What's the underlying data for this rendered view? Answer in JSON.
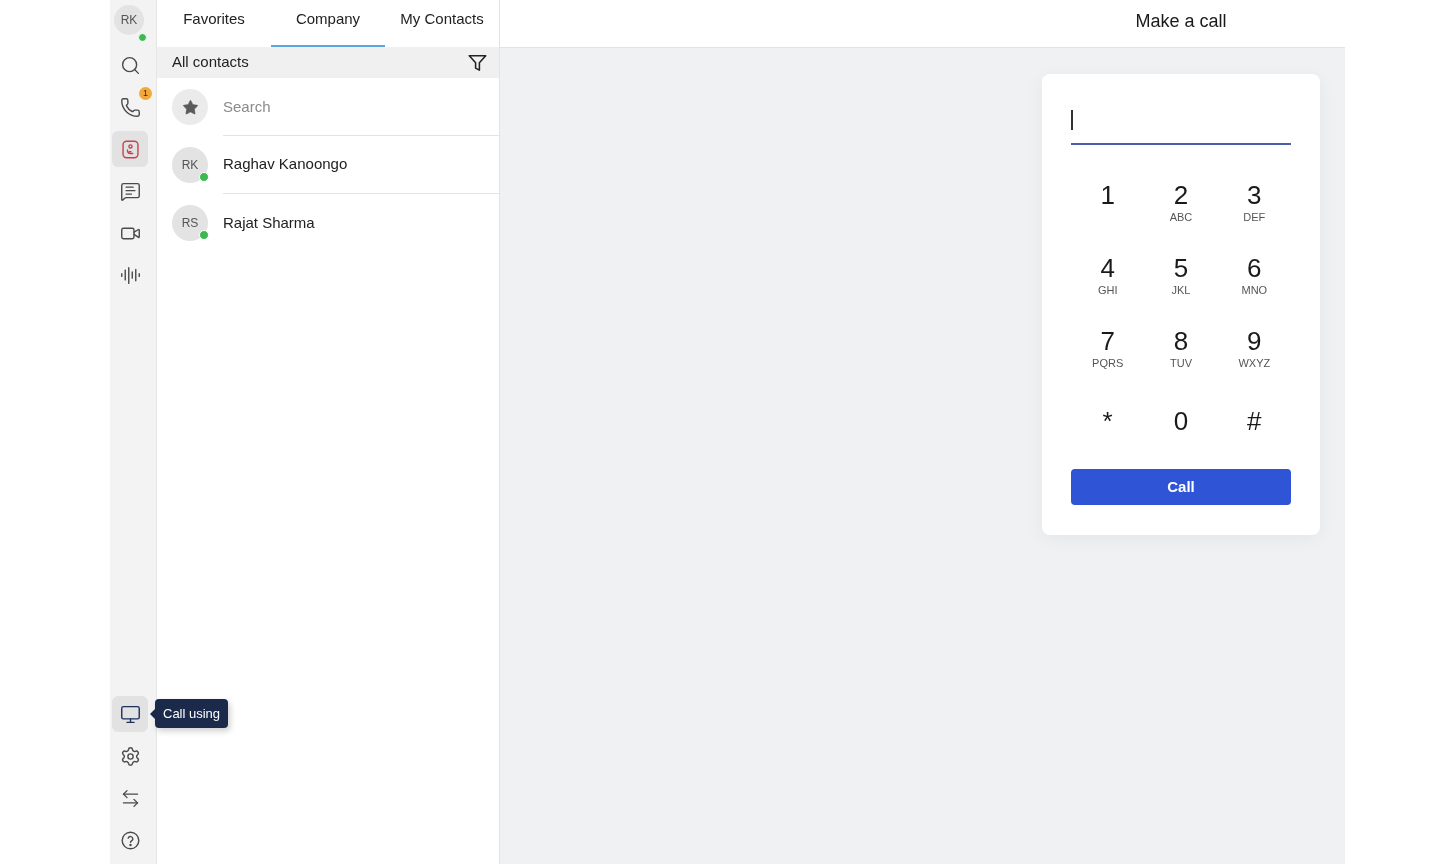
{
  "rail": {
    "user": {
      "initials": "RK",
      "online": true
    },
    "items": [
      {
        "kind": "search",
        "selected": false
      },
      {
        "kind": "calls",
        "selected": false,
        "badge": "1"
      },
      {
        "kind": "contacts",
        "selected": true
      },
      {
        "kind": "chat",
        "selected": false
      },
      {
        "kind": "video",
        "selected": false
      },
      {
        "kind": "voicemail",
        "selected": false
      }
    ],
    "bottom_items": [
      {
        "kind": "call_using",
        "selected": true,
        "tooltip": "Call using"
      },
      {
        "kind": "settings",
        "selected": false
      },
      {
        "kind": "switch",
        "selected": false
      },
      {
        "kind": "help",
        "selected": false
      }
    ]
  },
  "contacts_panel": {
    "tabs": [
      {
        "label": "Favorites",
        "selected": false
      },
      {
        "label": "Company",
        "selected": true
      },
      {
        "label": "My Contacts",
        "selected": false
      }
    ],
    "filter_label": "All contacts",
    "search": {
      "placeholder": "Search"
    },
    "contacts": [
      {
        "initials": "RK",
        "name": "Raghav Kanoongo",
        "online": true
      },
      {
        "initials": "RS",
        "name": "Rajat Sharma",
        "online": true
      }
    ]
  },
  "dialer": {
    "title": "Make a call",
    "input": {
      "focused": true
    },
    "keys": [
      {
        "digit": "1"
      },
      {
        "digit": "2",
        "letters": "ABC"
      },
      {
        "digit": "3",
        "letters": "DEF"
      },
      {
        "digit": "4",
        "letters": "GHI"
      },
      {
        "digit": "5",
        "letters": "JKL"
      },
      {
        "digit": "6",
        "letters": "MNO"
      },
      {
        "digit": "7",
        "letters": "PQRS"
      },
      {
        "digit": "8",
        "letters": "TUV"
      },
      {
        "digit": "9",
        "letters": "WXYZ"
      },
      {
        "digit": "*"
      },
      {
        "digit": "0"
      },
      {
        "digit": "#"
      }
    ],
    "call_button": "Call"
  }
}
